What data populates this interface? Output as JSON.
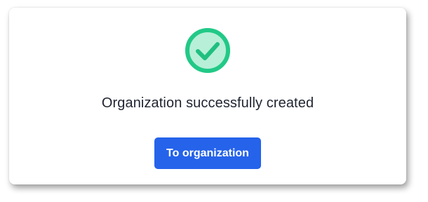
{
  "dialog": {
    "icon": "check-circle-icon",
    "message": "Organization successfully created",
    "button_label": "To organization"
  },
  "colors": {
    "success_green": "#22c987",
    "success_green_fill": "#b8efd8",
    "button_blue": "#2563eb",
    "text_dark": "#1f2430"
  }
}
